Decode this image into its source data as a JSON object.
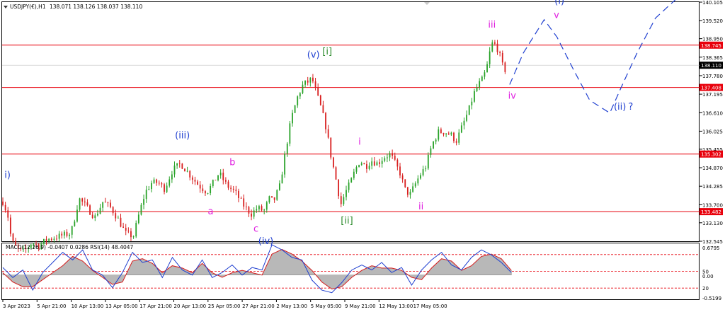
{
  "main": {
    "symbol_label": "USDJPY(€),H1",
    "ohlc_label": "138.071 138.126 138.037 138.110",
    "colors": {
      "up": "#28a228",
      "down": "#d81e1e",
      "level": "#e8000b",
      "wave": "#1f3fd0",
      "pink": "#e020e0",
      "green": "#2a8a2a",
      "badge_bg": "#e8000b",
      "current_bg": "#000000"
    }
  },
  "chart_data": [
    {
      "type": "candlestick",
      "symbol": "USDJPY(€)",
      "timeframe": "H1",
      "ylim": [
        132.545,
        140.105
      ],
      "y_ticks": [
        "140.105",
        "139.520",
        "138.950",
        "138.365",
        "137.780",
        "137.195",
        "136.610",
        "136.025",
        "135.455",
        "134.870",
        "134.285",
        "133.700",
        "133.130",
        "132.545"
      ],
      "x_ticks": [
        "3 Apr 2023",
        "5 Apr 21:00",
        "10 Apr 13:00",
        "13 Apr 05:00",
        "17 Apr 21:00",
        "20 Apr 13:00",
        "25 Apr 05:00",
        "27 Apr 21:00",
        "2 May 13:00",
        "5 May 05:00",
        "9 May 21:00",
        "12 May 13:00",
        "17 May 05:00"
      ],
      "price_path": [
        [
          0,
          133.8
        ],
        [
          0.6,
          133.4
        ],
        [
          1.0,
          132.7
        ],
        [
          1.4,
          132.4
        ],
        [
          1.9,
          132.3
        ],
        [
          2.4,
          132.2
        ],
        [
          3.0,
          132.3
        ],
        [
          3.6,
          132.5
        ],
        [
          4.5,
          132.4
        ],
        [
          5.5,
          132.6
        ],
        [
          7.0,
          132.7
        ],
        [
          8.5,
          132.8
        ],
        [
          9.0,
          133.3
        ],
        [
          9.5,
          133.9
        ],
        [
          10.2,
          133.7
        ],
        [
          11.5,
          133.3
        ],
        [
          12.5,
          133.8
        ],
        [
          13.5,
          133.6
        ],
        [
          14.5,
          133.2
        ],
        [
          15.3,
          132.8
        ],
        [
          16.3,
          132.7
        ],
        [
          17.0,
          133.4
        ],
        [
          17.8,
          134.1
        ],
        [
          18.6,
          134.4
        ],
        [
          19.4,
          134.4
        ],
        [
          20.2,
          134.2
        ],
        [
          21.2,
          134.8
        ],
        [
          22.2,
          135.0
        ],
        [
          23.5,
          134.6
        ],
        [
          24.5,
          134.3
        ],
        [
          25.5,
          134.1
        ],
        [
          26.3,
          134.4
        ],
        [
          27.0,
          134.7
        ],
        [
          28.0,
          134.3
        ],
        [
          29.0,
          134.1
        ],
        [
          30.0,
          133.7
        ],
        [
          31.0,
          133.4
        ],
        [
          31.8,
          133.6
        ],
        [
          32.6,
          133.5
        ],
        [
          33.3,
          133.9
        ],
        [
          33.8,
          133.8
        ],
        [
          34.6,
          134.3
        ],
        [
          35.3,
          135.4
        ],
        [
          36.0,
          136.4
        ],
        [
          36.8,
          137.1
        ],
        [
          37.5,
          137.5
        ],
        [
          38.2,
          137.6
        ],
        [
          38.6,
          137.7
        ],
        [
          39.2,
          137.2
        ],
        [
          39.8,
          136.7
        ],
        [
          40.4,
          136.1
        ],
        [
          41.0,
          135.2
        ],
        [
          41.6,
          134.5
        ],
        [
          42.2,
          133.7
        ],
        [
          42.8,
          134.1
        ],
        [
          43.4,
          134.4
        ],
        [
          44.0,
          134.8
        ],
        [
          44.6,
          135.1
        ],
        [
          45.3,
          134.9
        ],
        [
          46.0,
          135.1
        ],
        [
          46.8,
          135.0
        ],
        [
          47.6,
          135.2
        ],
        [
          48.4,
          135.3
        ],
        [
          49.0,
          135.0
        ],
        [
          49.6,
          134.7
        ],
        [
          50.2,
          134.2
        ],
        [
          50.8,
          134.0
        ],
        [
          51.4,
          134.3
        ],
        [
          52.0,
          134.6
        ],
        [
          52.8,
          134.9
        ],
        [
          53.6,
          135.6
        ],
        [
          54.4,
          136.0
        ],
        [
          55.2,
          136.0
        ],
        [
          56.0,
          135.9
        ],
        [
          56.6,
          135.7
        ],
        [
          57.4,
          136.2
        ],
        [
          58.2,
          136.7
        ],
        [
          58.8,
          137.2
        ],
        [
          59.4,
          137.5
        ],
        [
          60.0,
          137.7
        ],
        [
          60.6,
          138.2
        ],
        [
          61.0,
          138.8
        ],
        [
          61.6,
          138.75
        ],
        [
          62.2,
          138.3
        ],
        [
          62.6,
          137.9
        ],
        [
          63.0,
          138.1
        ]
      ],
      "levels": [
        {
          "value": 138.745,
          "label": "138.745"
        },
        {
          "value": 137.408,
          "label": "137.408"
        },
        {
          "value": 135.302,
          "label": "135.302"
        },
        {
          "value": 133.482,
          "label": "133.482"
        }
      ],
      "current_price": {
        "value": 138.11,
        "label": "138.110"
      },
      "projection_path": [
        [
          63.3,
          137.5
        ],
        [
          65.0,
          138.5
        ],
        [
          67.6,
          139.55
        ],
        [
          69.2,
          139.0
        ],
        [
          71.2,
          138.0
        ],
        [
          73.3,
          137.0
        ],
        [
          75.8,
          136.6
        ],
        [
          77.2,
          137.4
        ],
        [
          79.2,
          138.5
        ],
        [
          81.5,
          139.6
        ],
        [
          84.5,
          140.3
        ]
      ],
      "annotations": [
        {
          "text": "i)",
          "group": "blue",
          "x": 0.2,
          "y": 134.55
        },
        {
          "text": "(iii)",
          "group": "blue",
          "x": 21.5,
          "y": 135.8
        },
        {
          "text": "b",
          "group": "pink",
          "x": 28.3,
          "y": 134.95
        },
        {
          "text": "a",
          "group": "pink",
          "x": 25.6,
          "y": 133.4
        },
        {
          "text": "c",
          "group": "pink",
          "x": 31.3,
          "y": 132.85
        },
        {
          "text": "(iv)",
          "group": "blue",
          "x": 31.9,
          "y": 132.45
        },
        {
          "text": "(v)",
          "group": "blue",
          "x": 38.0,
          "y": 138.35
        },
        {
          "text": "[i]",
          "group": "green",
          "x": 39.9,
          "y": 138.45
        },
        {
          "text": "[ii]",
          "group": "green",
          "x": 42.2,
          "y": 133.1
        },
        {
          "text": "i",
          "group": "pink",
          "x": 44.4,
          "y": 135.6
        },
        {
          "text": "ii",
          "group": "pink",
          "x": 51.9,
          "y": 133.55
        },
        {
          "text": "iii",
          "group": "pink",
          "x": 60.6,
          "y": 139.3
        },
        {
          "text": "iv",
          "group": "pink",
          "x": 63.1,
          "y": 137.05
        },
        {
          "text": "v",
          "group": "pink",
          "x": 68.8,
          "y": 139.6
        },
        {
          "text": "(i)",
          "group": "blue",
          "x": 68.9,
          "y": 140.05
        },
        {
          "text": "(ii)",
          "group": "blue",
          "x": 76.3,
          "y": 136.7
        },
        {
          "text": "?",
          "group": "blue",
          "x": 78.1,
          "y": 136.7
        }
      ]
    },
    {
      "type": "line",
      "indicator": "MACD(12,26,9) / RSI(14)",
      "title": "MACD(12,26,9) -0.0407 0.0286 RSI(14) 48.4047",
      "ylim": [
        -0.5199,
        0.6795
      ],
      "y_ticks": [
        "0.6795",
        "50",
        "0.00",
        "20",
        "-0.5199"
      ],
      "levels": [
        80,
        50,
        20
      ],
      "series": [
        {
          "values": [
            0.05,
            -0.15,
            -0.25,
            -0.25,
            -0.1,
            0.05,
            0.2,
            0.4,
            0.3,
            0.1,
            -0.05,
            -0.2,
            -0.15,
            0.3,
            0.35,
            0.25,
            0.05,
            0.2,
            0.15,
            0.05,
            0.25,
            0.05,
            -0.05,
            0.05,
            0.1,
            0.05,
            0.0,
            0.45,
            0.55,
            0.45,
            0.3,
            0.1,
            -0.15,
            -0.3,
            -0.25,
            -0.05,
            0.1,
            0.2,
            0.15,
            0.15,
            0.1,
            -0.05,
            -0.1,
            0.15,
            0.35,
            0.3,
            0.1,
            0.2,
            0.4,
            0.45,
            0.35,
            0.1
          ]
        },
        {
          "values": [
            0.15,
            -0.05,
            0.1,
            -0.3,
            0.05,
            0.25,
            0.45,
            0.3,
            0.5,
            0.1,
            0.0,
            -0.25,
            0.05,
            0.45,
            0.25,
            0.3,
            -0.05,
            0.35,
            0.1,
            0.0,
            0.3,
            -0.05,
            0.05,
            0.2,
            0.0,
            0.15,
            0.1,
            0.6,
            0.5,
            0.35,
            0.3,
            -0.1,
            -0.3,
            -0.35,
            -0.15,
            0.1,
            0.2,
            0.1,
            0.25,
            0.05,
            0.15,
            -0.2,
            0.1,
            0.3,
            0.45,
            0.2,
            0.1,
            0.35,
            0.5,
            0.4,
            0.25,
            0.05
          ]
        }
      ]
    }
  ]
}
